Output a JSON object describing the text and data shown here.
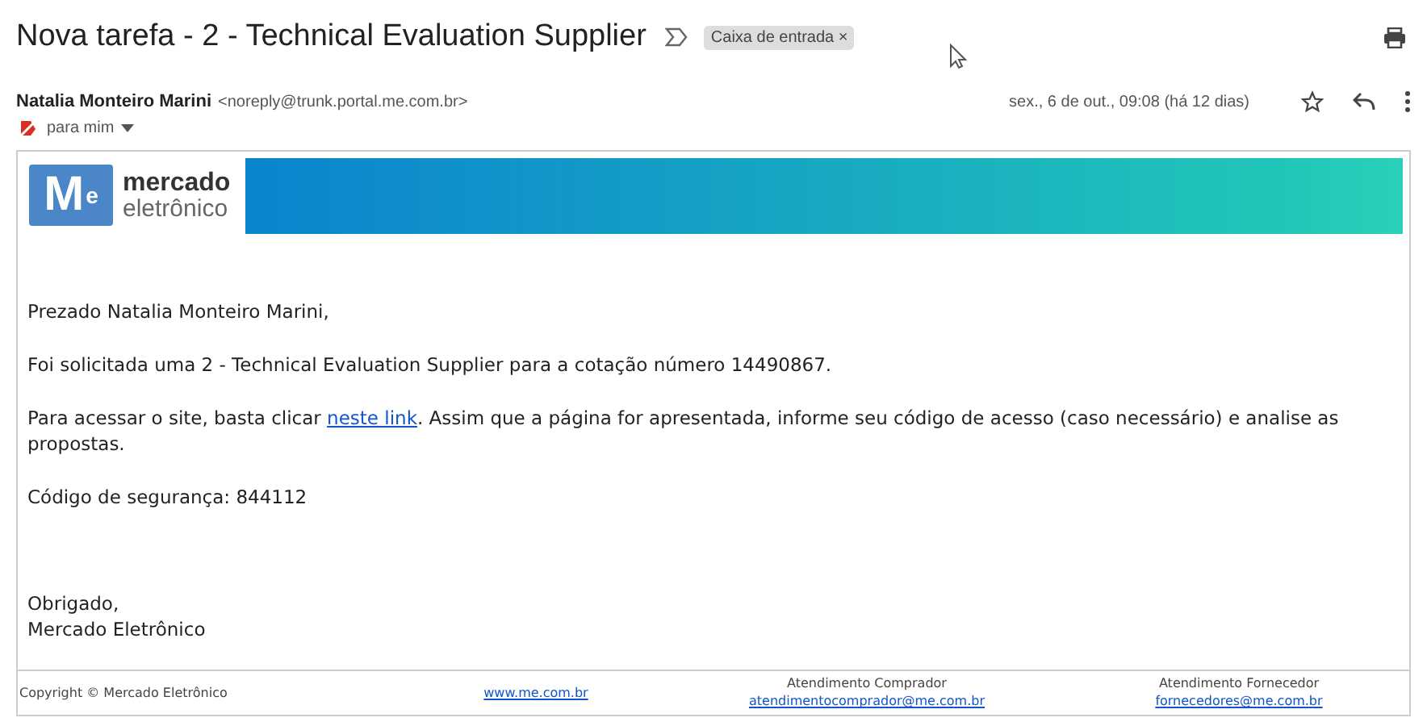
{
  "subject": "Nova tarefa - 2 - Technical Evaluation Supplier",
  "label": {
    "text": "Caixa de entrada",
    "close": "×"
  },
  "sender": {
    "name": "Natalia Monteiro Marini",
    "email": "<noreply@trunk.portal.me.com.br>",
    "recipient": "para mim",
    "date": "sex., 6 de out., 09:08 (há 12 dias)",
    "starred": false
  },
  "logo": {
    "mark": "M",
    "mark_sup": "e",
    "line1": "mercado",
    "line2": "eletrônico"
  },
  "body": {
    "greeting": "Prezado Natalia Monteiro Marini,",
    "request": "Foi solicitada uma 2 - Technical Evaluation Supplier para a cotação número 14490867.",
    "access_before": "Para acessar o site, basta clicar ",
    "access_link": "neste link",
    "access_after": ". Assim que a página for apresentada, informe seu código de acesso (caso necessário) e analise as propostas.",
    "code": "Código de segurança: 844112",
    "closing": "Obrigado,",
    "signature": "Mercado Eletrônico"
  },
  "footer": {
    "copyright": "Copyright © Mercado Eletrônico",
    "website": "www.me.com.br",
    "buyer_title": "Atendimento Comprador",
    "buyer_email": "atendimentocomprador@me.com.br",
    "supplier_title": "Atendimento Fornecedor",
    "supplier_email": "fornecedores@me.com.br"
  }
}
